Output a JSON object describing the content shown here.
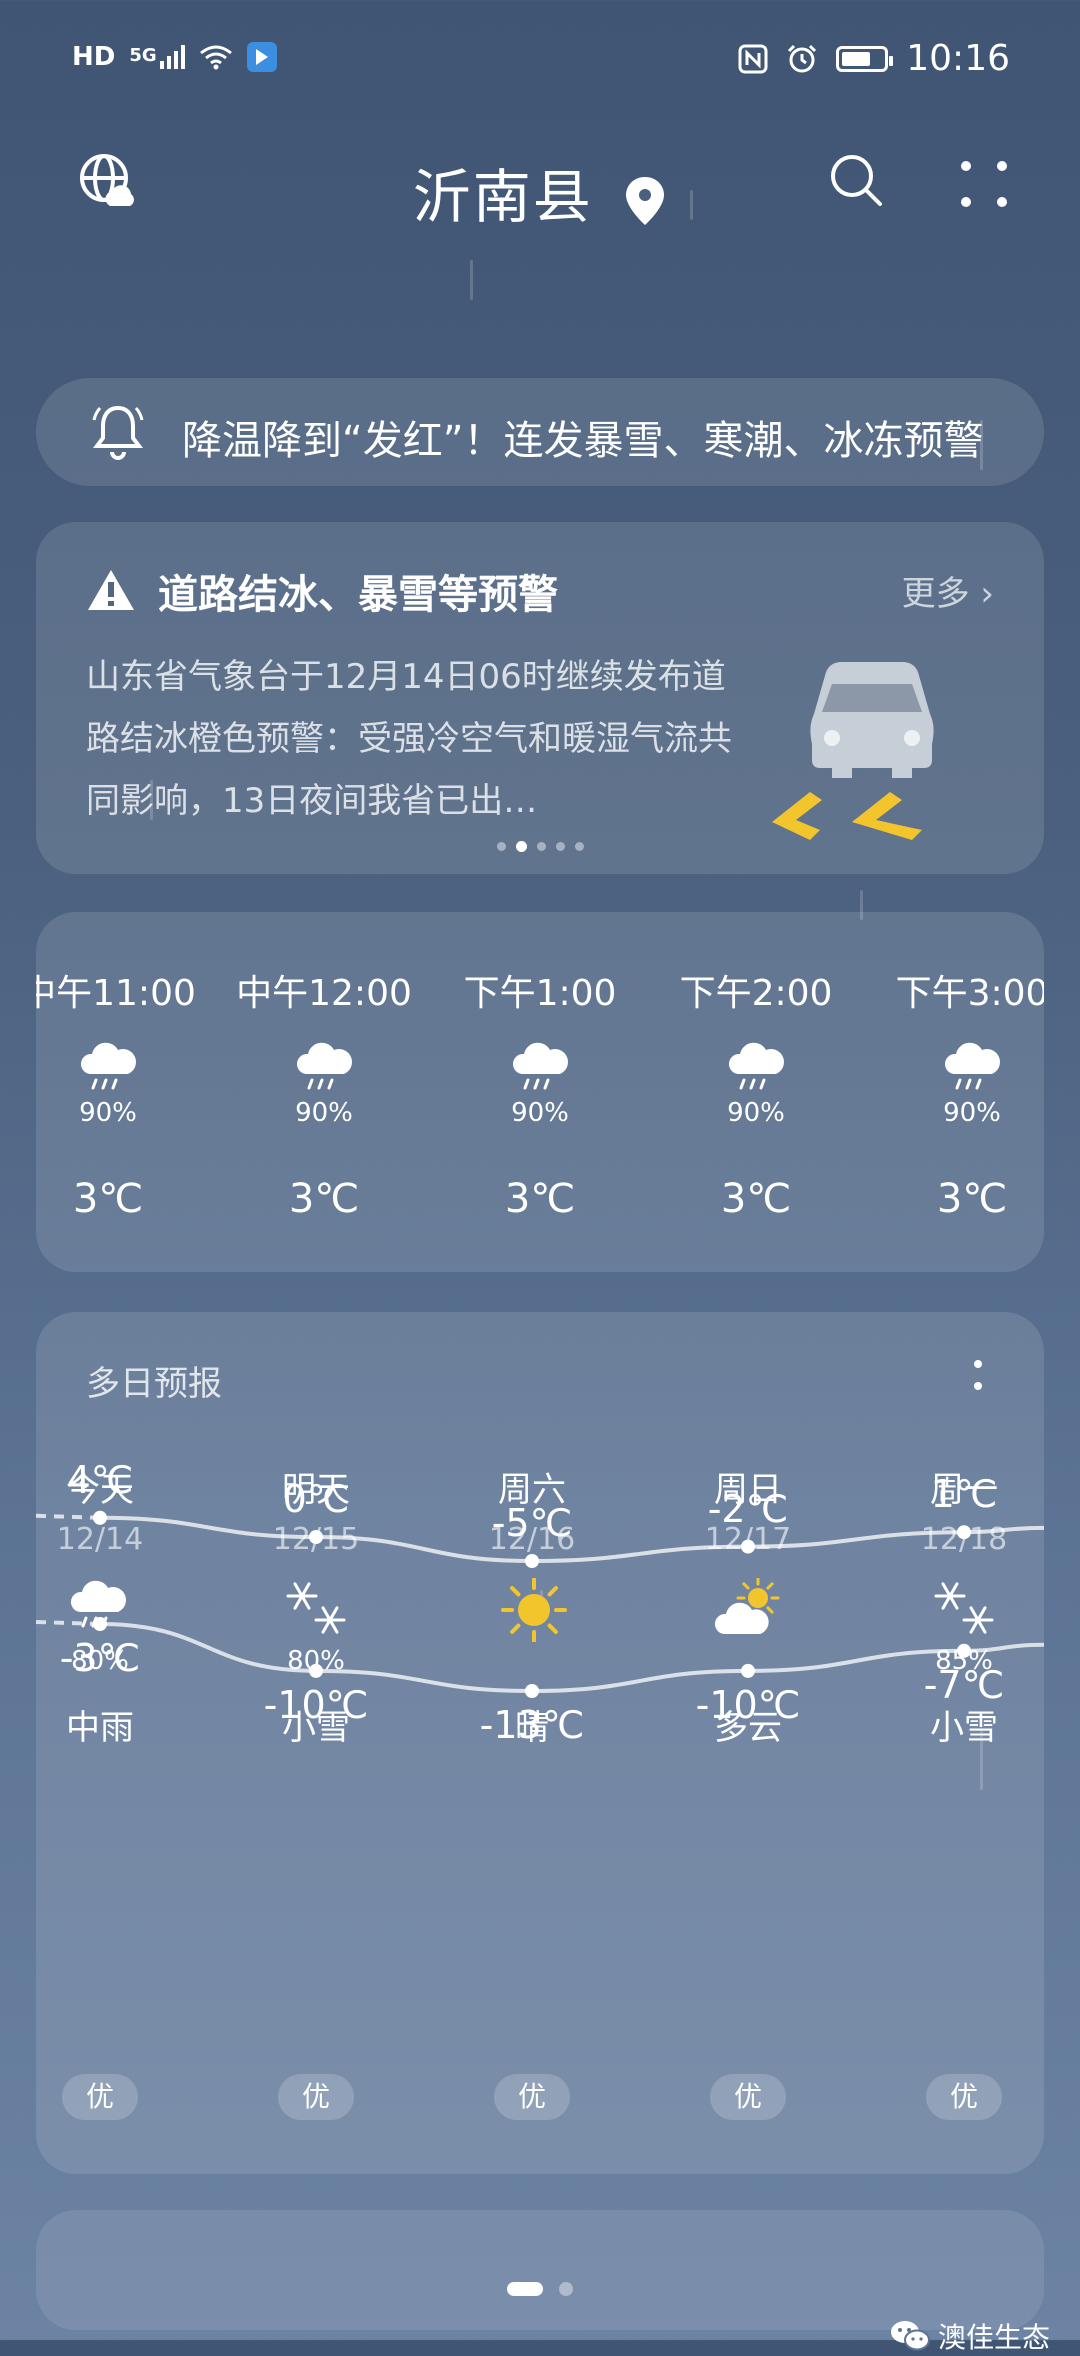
{
  "status_bar": {
    "left_text": [
      "HD",
      "5G"
    ],
    "time": "10:16",
    "battery_level": 0.7
  },
  "header": {
    "city": "沂南县"
  },
  "ticker": {
    "text": "降温降到“发红”！连发暴雪、寒潮、冰冻预警"
  },
  "alert": {
    "title": "道路结冰、暴雪等预警",
    "more_label": "更多 ›",
    "body": "山东省气象台于12月14日06时继续发布道路结冰橙色预警：受强冷空气和暖湿气流共同影响，13日夜间我省已出…",
    "carousel_count": 5,
    "carousel_active": 1
  },
  "hourly": [
    {
      "time": "中午11:00",
      "pop": "90%",
      "temp": "3℃",
      "icon": "rain-cloud-icon"
    },
    {
      "time": "中午12:00",
      "pop": "90%",
      "temp": "3℃",
      "icon": "rain-cloud-icon"
    },
    {
      "time": "下午1:00",
      "pop": "90%",
      "temp": "3℃",
      "icon": "rain-cloud-icon"
    },
    {
      "time": "下午2:00",
      "pop": "90%",
      "temp": "3℃",
      "icon": "rain-cloud-icon"
    },
    {
      "time": "下午3:00",
      "pop": "90%",
      "temp": "3℃",
      "icon": "rain-cloud-icon"
    }
  ],
  "daily": {
    "title": "多日预报",
    "days": [
      {
        "name": "今天",
        "date": "12/14",
        "icon": "rain-cloud-icon",
        "pop": "80%",
        "cond": "中雨",
        "high": 4,
        "high_label": "4℃",
        "low": -3,
        "low_label": "-3℃",
        "aqi": "优"
      },
      {
        "name": "明天",
        "date": "12/15",
        "icon": "snowflake-icon",
        "pop": "80%",
        "cond": "小雪",
        "high": 0,
        "high_label": "0℃",
        "low": -10,
        "low_label": "-10℃",
        "aqi": "优"
      },
      {
        "name": "周六",
        "date": "12/16",
        "icon": "sun-icon",
        "pop": "",
        "cond": "晴",
        "high": -5,
        "high_label": "-5℃",
        "low": -13,
        "low_label": "-13℃",
        "aqi": "优"
      },
      {
        "name": "周日",
        "date": "12/17",
        "icon": "partly-cloudy-icon",
        "pop": "",
        "cond": "多云",
        "high": -2,
        "high_label": "-2℃",
        "low": -10,
        "low_label": "-10℃",
        "aqi": "优"
      },
      {
        "name": "周一",
        "date": "12/18",
        "icon": "snowflake-icon",
        "pop": "85%",
        "cond": "小雪",
        "high": 1,
        "high_label": "1℃",
        "low": -7,
        "low_label": "-7℃",
        "aqi": "优"
      }
    ]
  },
  "page_indicator": {
    "count": 2,
    "active": 0
  },
  "watermark": {
    "text": "澳佳生态"
  }
}
